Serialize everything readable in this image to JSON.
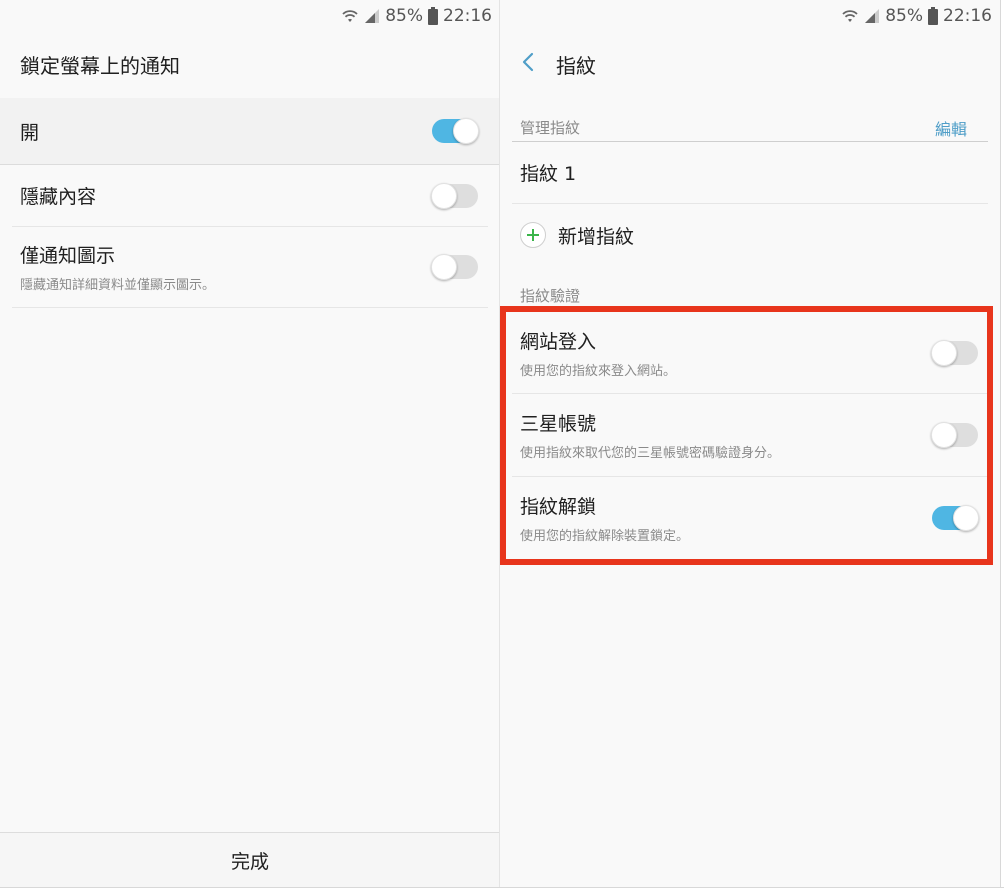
{
  "status_bar": {
    "battery": "85%",
    "time": "22:16"
  },
  "left_screen": {
    "title": "鎖定螢幕上的通知",
    "rows": [
      {
        "title": "開",
        "toggle": "on"
      },
      {
        "title": "隱藏內容",
        "toggle": "off"
      },
      {
        "title": "僅通知圖示",
        "subtitle": "隱藏通知詳細資料並僅顯示圖示。",
        "toggle": "off"
      }
    ],
    "done_label": "完成"
  },
  "right_screen": {
    "title": "指紋",
    "manage_section": "管理指紋",
    "edit_label": "編輯",
    "fingerprint_item": "指紋 1",
    "add_label": "新增指紋",
    "verify_section": "指紋驗證",
    "rows": [
      {
        "title": "網站登入",
        "subtitle": "使用您的指紋來登入網站。",
        "toggle": "off"
      },
      {
        "title": "三星帳號",
        "subtitle": "使用指紋來取代您的三星帳號密碼驗證身分。",
        "toggle": "off"
      },
      {
        "title": "指紋解鎖",
        "subtitle": "使用您的指紋解除裝置鎖定。",
        "toggle": "on"
      }
    ]
  },
  "colors": {
    "accent": "#4fb6e3",
    "highlight": "#e8351c",
    "link": "#4f9ec8",
    "add_green": "#3bb54a"
  },
  "icons": [
    "wifi-icon",
    "signal-icon",
    "battery-icon",
    "back-chevron-icon",
    "add-icon"
  ]
}
